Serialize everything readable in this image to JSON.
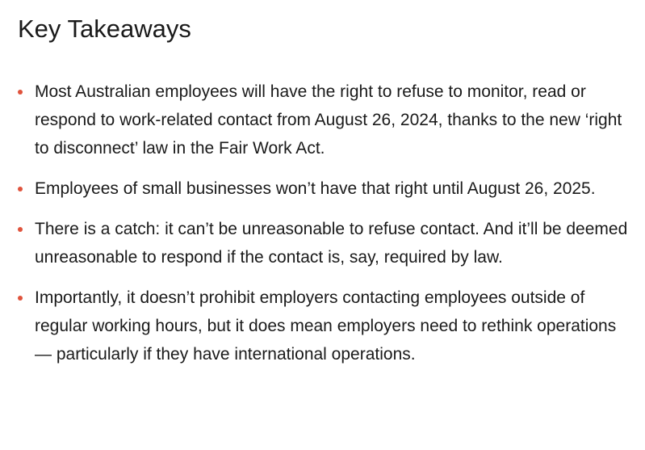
{
  "title": "Key Takeaways",
  "colors": {
    "bullet": "#e0533c",
    "text": "#1a1a1a"
  },
  "takeaways": [
    "Most Australian employees will have the right to refuse to monitor, read or respond to work-related contact from August 26, 2024, thanks to the new ‘right to disconnect’ law in the Fair Work Act.",
    "Employees of small businesses won’t have that right until August 26, 2025.",
    "There is a catch: it can’t be unreasonable to refuse contact. And it’ll be deemed unreasonable to respond if the contact is, say, required by law.",
    "Importantly, it doesn’t prohibit employers contacting employees outside of regular working hours, but it does mean employers need to rethink operations — particularly if they have international operations."
  ]
}
